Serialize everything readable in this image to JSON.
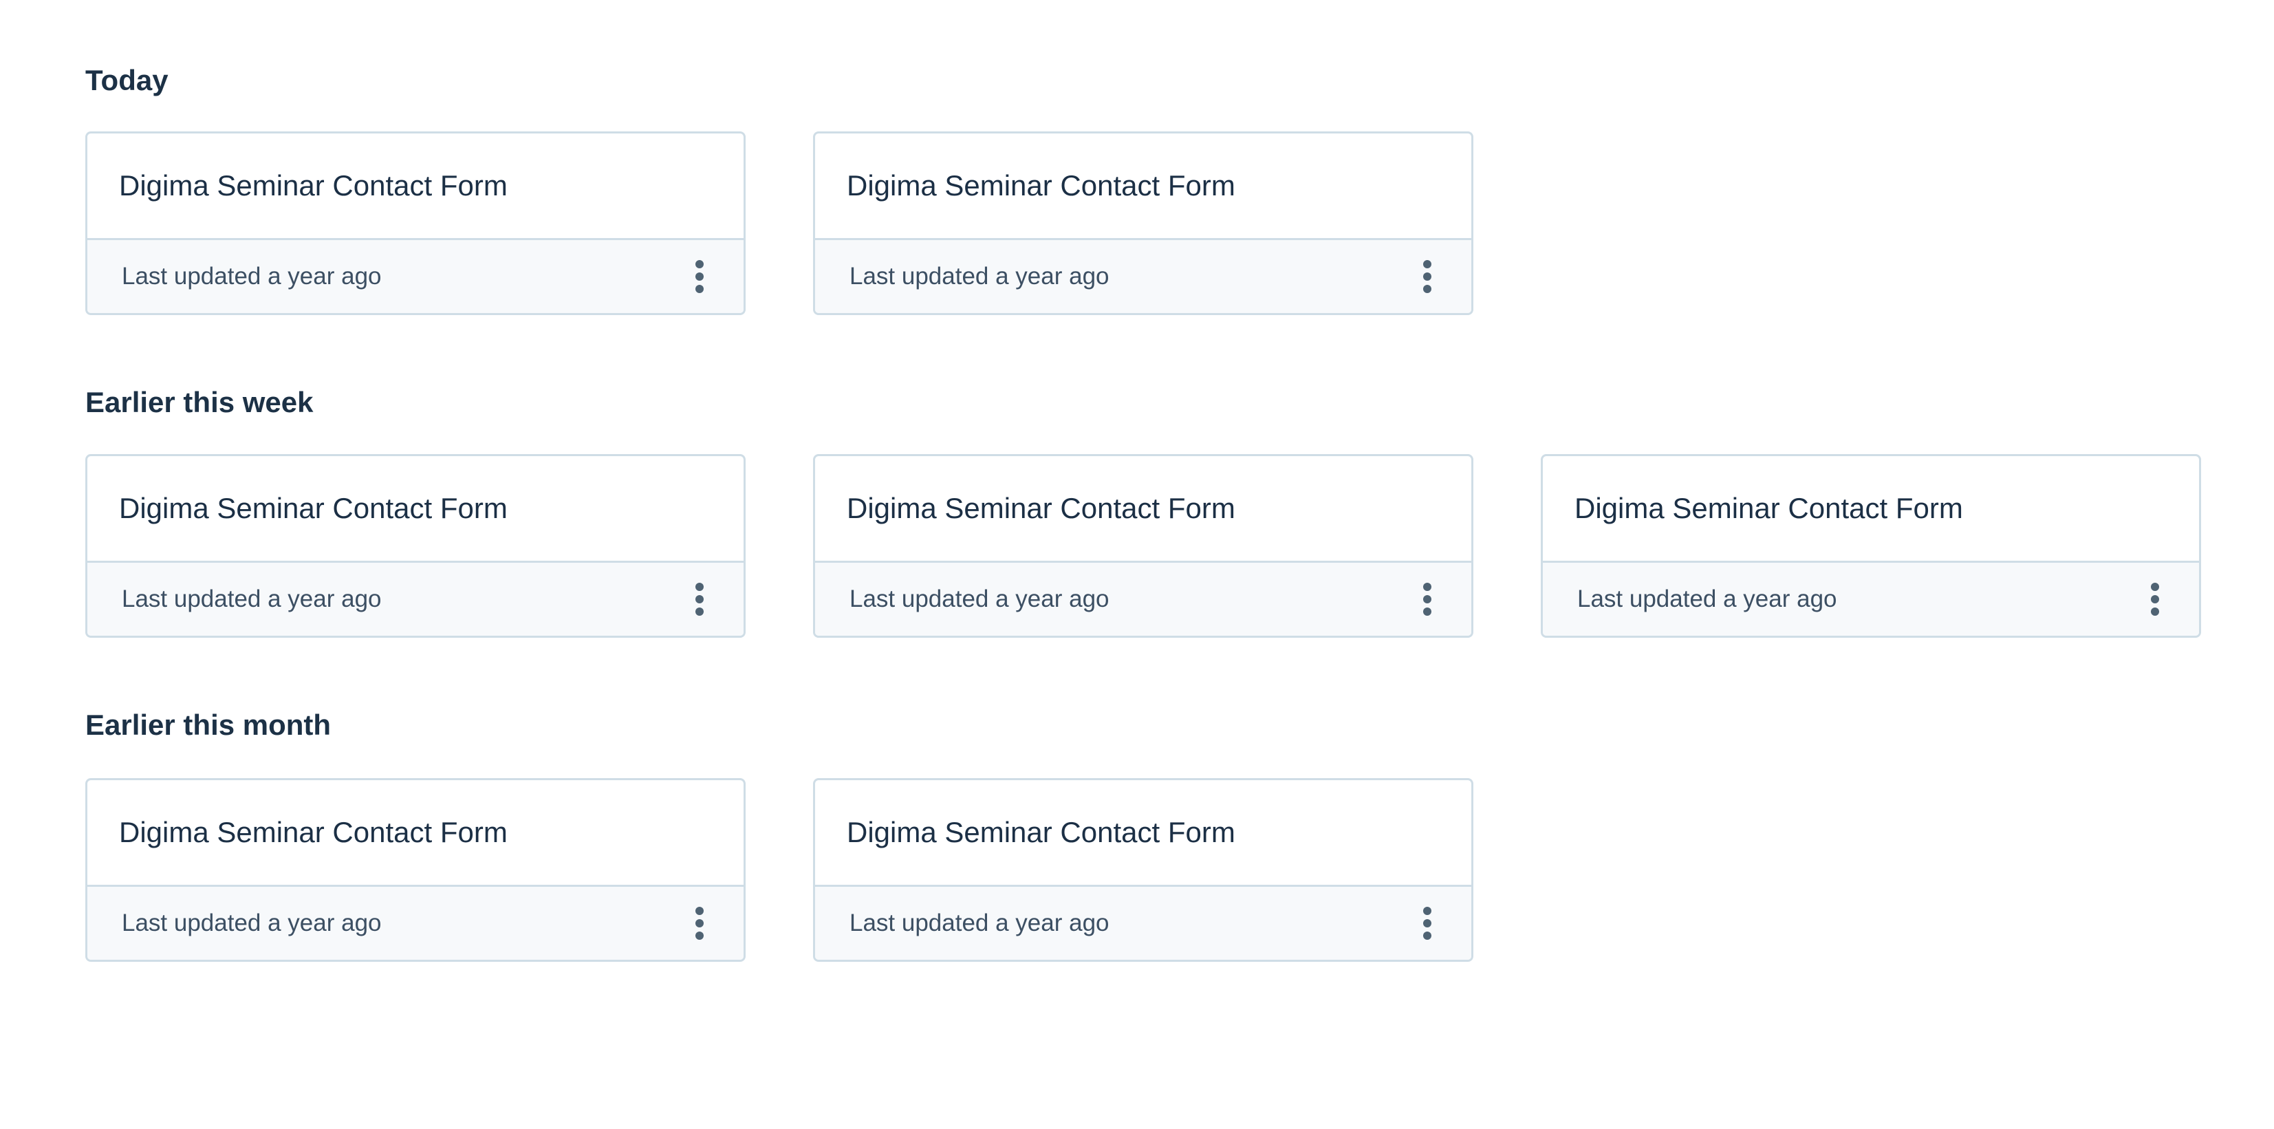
{
  "sections": [
    {
      "title": "Today",
      "cards": [
        {
          "title": "Digima Seminar Contact Form",
          "meta": "Last updated a year ago"
        },
        {
          "title": "Digima Seminar Contact Form",
          "meta": "Last updated a year ago"
        }
      ]
    },
    {
      "title": "Earlier this week",
      "cards": [
        {
          "title": "Digima Seminar Contact Form",
          "meta": "Last updated a year ago"
        },
        {
          "title": "Digima Seminar Contact Form",
          "meta": "Last updated a year ago"
        },
        {
          "title": "Digima Seminar Contact Form",
          "meta": "Last updated a year ago"
        }
      ]
    },
    {
      "title": "Earlier this month",
      "cards": [
        {
          "title": "Digima Seminar Contact Form",
          "meta": "Last updated a year ago"
        },
        {
          "title": "Digima Seminar Contact Form",
          "meta": "Last updated a year ago"
        }
      ]
    }
  ],
  "icons": {
    "card_menu": "more-vertical-icon"
  },
  "colors": {
    "heading": "#1c3146",
    "card_border": "#cfdde6",
    "card_footer_bg": "#f7f9fb",
    "icon": "#4f6373"
  }
}
